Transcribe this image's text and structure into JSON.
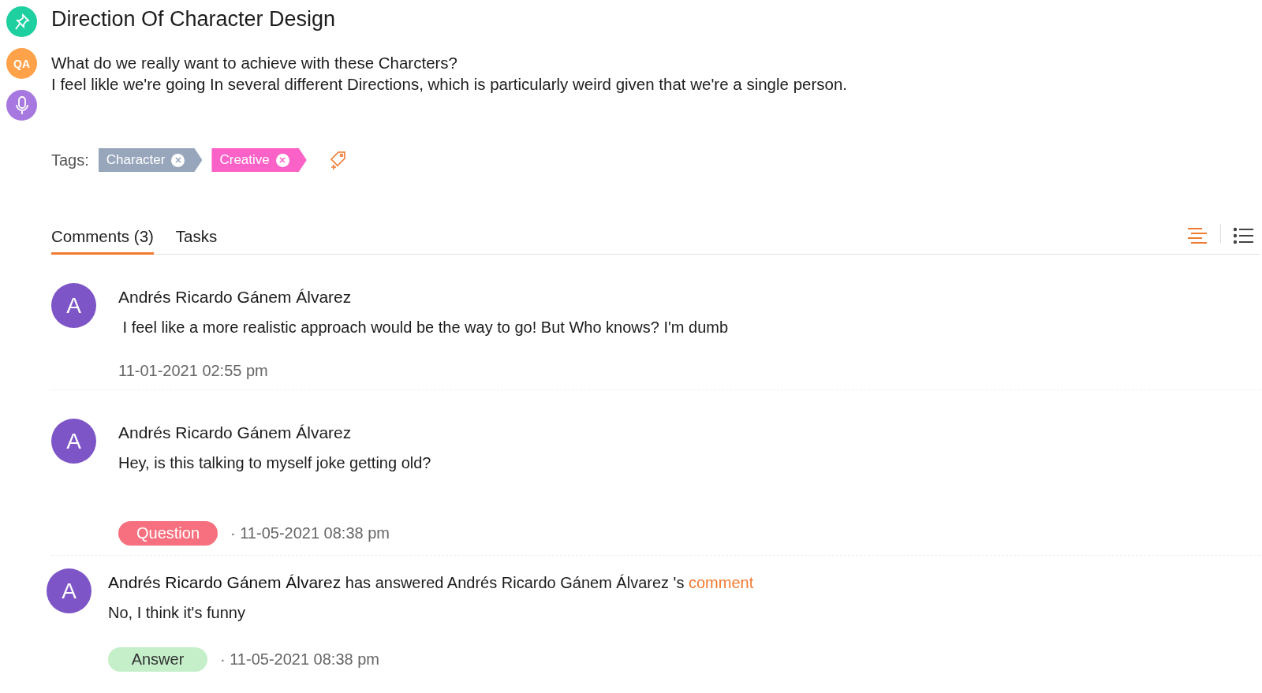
{
  "side_icons": [
    {
      "kind": "pin",
      "color": "#1ecf9f"
    },
    {
      "kind": "qa",
      "label": "QA",
      "color": "#ffa24a"
    },
    {
      "kind": "mic",
      "color": "#a678e0"
    }
  ],
  "title": "Direction Of Character Design",
  "description": [
    "What do we really want to achieve with these Charcters?",
    "I feel likle we're going In several different Directions, which is particularly weird given that we're a single person."
  ],
  "tags_label": "Tags:",
  "tags": [
    {
      "label": "Character",
      "color": "#98a6bb"
    },
    {
      "label": "Creative",
      "color": "#fb62c8"
    }
  ],
  "tabs": [
    {
      "label": "Comments (3)",
      "selected": true
    },
    {
      "label": "Tasks",
      "selected": false
    }
  ],
  "view_modes": [
    {
      "kind": "sort",
      "selected": true
    },
    {
      "kind": "list",
      "selected": false
    }
  ],
  "comments": [
    {
      "kind": "comment",
      "avatar": "A",
      "author": "Andrés Ricardo Gánem Álvarez",
      "text": " I feel like a more realistic approach would be the way to go! But Who knows? I'm dumb",
      "date": "11-01-2021 02:55 pm"
    },
    {
      "kind": "comment",
      "avatar": "A",
      "author": "Andrés Ricardo Gánem Álvarez",
      "text": "Hey, is this talking to myself joke getting old?",
      "badge": {
        "kind": "question",
        "label": "Question"
      },
      "date": "· 11-05-2021 08:38 pm"
    },
    {
      "kind": "reply",
      "avatar": "A",
      "header": "**Andrés Ricardo Gánem Álvarez** has answered Andrés Ricardo Gánem Álvarez 's",
      "link": "comment",
      "text": "No, I think it's funny",
      "badge": {
        "kind": "answer",
        "label": "Answer"
      },
      "date": "· 11-05-2021 08:38 pm"
    }
  ]
}
